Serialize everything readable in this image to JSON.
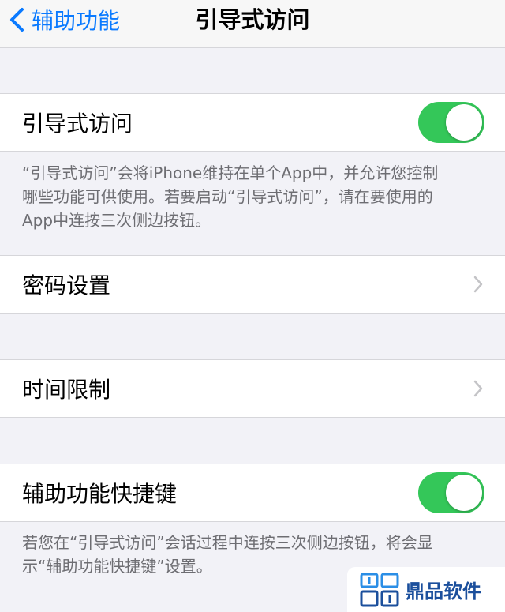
{
  "nav": {
    "back_label": "辅助功能",
    "title": "引导式访问"
  },
  "rows": {
    "guided_access": {
      "label": "引导式访问",
      "toggle_on": true
    },
    "passcode": {
      "label": "密码设置"
    },
    "time_limit": {
      "label": "时间限制"
    },
    "shortcut": {
      "label": "辅助功能快捷键",
      "toggle_on": true
    }
  },
  "footers": {
    "guided_access_line1": "“引导式访问”会将iPhone维持在单个App中，并允许您控制",
    "guided_access_line2": "哪些功能可供使用。若要启动“引导式访问”，请在要使用的",
    "guided_access_line3": "App中连按三次侧边按钮。",
    "shortcut_line1": "若您在“引导式访问”会话过程中连按三次侧边按钮，将会显",
    "shortcut_line2": "示“辅助功能快捷键”设置。"
  },
  "watermark": {
    "text": "鼎品软件"
  },
  "colors": {
    "accent": "#0a7aff",
    "toggle_on": "#34c759",
    "background": "#f2f2f7",
    "footer_text": "#6d6d72"
  },
  "icons": {
    "back": "chevron-left-icon",
    "disclosure": "chevron-right-icon",
    "watermark": "logo-icon"
  }
}
